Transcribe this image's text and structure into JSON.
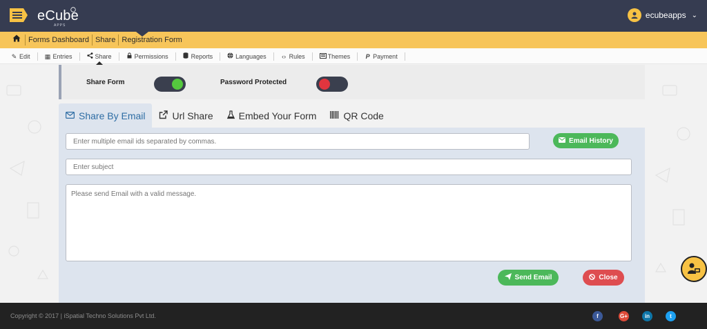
{
  "header": {
    "brand": "eCube",
    "brand_sub": "APPS",
    "username": "ecubeapps"
  },
  "breadcrumb": {
    "items": [
      "Forms Dashboard",
      "Share",
      "Registration Form"
    ]
  },
  "submenu": {
    "items": [
      {
        "label": "Edit",
        "icon": "edit-icon"
      },
      {
        "label": "Entries",
        "icon": "table-icon"
      },
      {
        "label": "Share",
        "icon": "share-icon"
      },
      {
        "label": "Permissions",
        "icon": "lock-icon"
      },
      {
        "label": "Reports",
        "icon": "database-icon"
      },
      {
        "label": "Languages",
        "icon": "globe-icon"
      },
      {
        "label": "Rules",
        "icon": "code-icon"
      },
      {
        "label": "Themes",
        "icon": "theme-icon"
      },
      {
        "label": "Payment",
        "icon": "paypal-icon"
      }
    ],
    "active": "Share"
  },
  "toggles": {
    "share_form": {
      "label": "Share Form",
      "state": "on",
      "color": "#55c93e"
    },
    "password_protected": {
      "label": "Password Protected",
      "state": "off",
      "color": "#e0353e"
    }
  },
  "tabs": [
    {
      "label": "Share By Email",
      "icon": "envelope-icon",
      "active": true
    },
    {
      "label": "Url Share",
      "icon": "external-link-icon",
      "active": false
    },
    {
      "label": "Embed Your Form",
      "icon": "flask-icon",
      "active": false
    },
    {
      "label": "QR Code",
      "icon": "barcode-icon",
      "active": false
    }
  ],
  "email_form": {
    "emails_placeholder": "Enter multiple email ids separated by commas.",
    "subject_placeholder": "Enter subject",
    "message_placeholder": "Please send Email with a valid message.",
    "email_history_label": "Email History",
    "send_label": "Send Email",
    "close_label": "Close"
  },
  "footer": {
    "copyright": "Copyright © 2017 | iSpatial Techno Solutions Pvt Ltd.",
    "social": [
      {
        "label": "f",
        "name": "facebook",
        "color": "#3b5998"
      },
      {
        "label": "G+",
        "name": "google-plus",
        "color": "#dd4b39"
      },
      {
        "label": "in",
        "name": "linkedin",
        "color": "#0e76a8"
      },
      {
        "label": "t",
        "name": "twitter",
        "color": "#1da1f2"
      }
    ]
  },
  "colors": {
    "header_bg": "#363c51",
    "breadcrumb_bg": "#f7c55a",
    "panel_bg": "#dde4ee",
    "active_tab_text": "#2e6da4",
    "button_green": "#4cb85a",
    "button_red": "#de4d50",
    "footer_bg": "#222222"
  }
}
